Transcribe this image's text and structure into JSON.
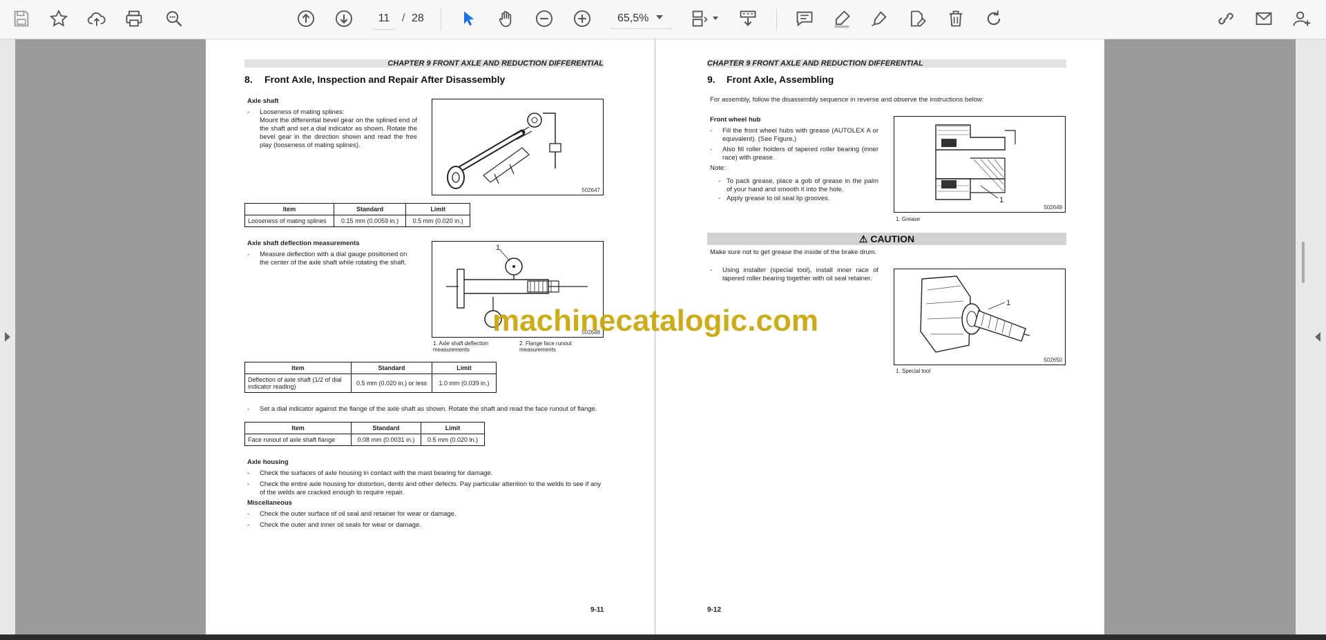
{
  "toolbar": {
    "page_current": "11",
    "page_sep": "/",
    "page_total": "28",
    "zoom": "65,5%",
    "icons": [
      "save-icon",
      "bookmark-star-icon",
      "upload-icon",
      "print-icon",
      "zoom-search-icon",
      "page-up-icon",
      "page-down-icon",
      "select-arrow-icon",
      "hand-icon",
      "zoom-out-icon",
      "zoom-in-icon",
      "page-fit-icon",
      "scroll-mode-icon",
      "comment-icon",
      "highlight-icon",
      "draw-icon",
      "edit-pdf-icon",
      "delete-icon",
      "redo-icon",
      "share-icon",
      "mail-icon",
      "add-user-icon"
    ]
  },
  "left_page": {
    "header": "CHAPTER 9 FRONT AXLE AND REDUCTION DIFFERENTIAL",
    "section_number": "8.",
    "section_title": "Front Axle, Inspection and Repair After Disassembly",
    "axle_shaft_heading": "Axle shaft",
    "axle_shaft_item": "Looseness of mating splines:",
    "axle_shaft_para": "Mount the differential bevel gear on the splined end of the shaft and set a dial indicator as shown. Rotate the bevel gear in the direction shown and read the free play (looseness of mating splines).",
    "fig1_code": "502647",
    "table1": {
      "headers": [
        "Item",
        "Standard",
        "Limit"
      ],
      "rows": [
        [
          "Looseness of mating splines",
          "0.15 mm (0.0059 in.)",
          "0.5 mm (0.020 in.)"
        ]
      ]
    },
    "deflection_heading": "Axle shaft deflection measurements",
    "deflection_item": "Measure deflection with a dial gauge positioned on the center of the axle shaft while rotating the shaft.",
    "fig2_code": "502648",
    "fig2_callout": "1",
    "fig2_cap1": "1. Axle shaft deflection measurements",
    "fig2_cap2": "2. Flange face runout measurements",
    "table2": {
      "headers": [
        "Item",
        "Standard",
        "Limit"
      ],
      "rows": [
        [
          "Deflection of axle shaft (1/2 of dial indicator reading)",
          "0.5 mm (0.020 in.) or less",
          "1.0 mm (0.039 in.)"
        ]
      ]
    },
    "runout_item": "Set a dial indicator against the flange of the axle shaft as shown. Rotate the shaft and read the face runout of flange.",
    "table3": {
      "headers": [
        "Item",
        "Standard",
        "Limit"
      ],
      "rows": [
        [
          "Face runout of axle shaft flange",
          "0.08 mm (0.0031 in.)",
          "0.5 mm (0.020 in.)"
        ]
      ]
    },
    "housing_heading": "Axle housing",
    "housing_item1": "Check the surfaces of axle housing in contact with the mast bearing for damage.",
    "housing_item2": "Check the entire axle housing for distortion, dents and other defects. Pay particular attention to the welds to see if any of the welds are cracked enough to require repair.",
    "misc_heading": "Miscellaneous",
    "misc_item1": "Check the outer surface of oil seal and retainer for wear or damage.",
    "misc_item2": "Check the outer and inner oil seals for wear or damage.",
    "page_number": "9-11"
  },
  "right_page": {
    "header": "CHAPTER 9 FRONT AXLE AND REDUCTION DIFFERENTIAL",
    "section_number": "9.",
    "section_title": "Front Axle, Assembling",
    "intro": "For assembly, follow the disassembly sequence in reverse and observe the instructions below:",
    "hub_heading": "Front wheel hub",
    "hub_item1": "Fill the front wheel hubs with grease (AUTOLEX A or equivalent). (See Figure.)",
    "hub_item2": "Also fill roller holders of tapered roller bearing (inner race) with grease.",
    "note_label": "Note:",
    "note_item1": "To pack grease, place a gob of grease in the palm of your hand and smooth it into the hole.",
    "note_item2": "Apply grease to oil seal lip grooves.",
    "fig3_code": "502649",
    "fig3_callout": "1",
    "fig3_cap": "1. Grease",
    "caution_title": "CAUTION",
    "caution_text": "Make sure not to get grease the inside of the brake drum.",
    "installer_item": "Using installer (special tool), install inner race of tapered roller bearing together with oil seal retainer.",
    "fig4_code": "502650",
    "fig4_callout": "1",
    "fig4_cap": "1. Special tool",
    "page_number": "9-12"
  },
  "watermark": "machinecatalogic.com",
  "colors": {
    "toolbar_bg": "#f7f7f7",
    "viewer_bg": "#9b9b9b",
    "select_tool_accent": "#1a73e8",
    "watermark": "#c9a400"
  }
}
